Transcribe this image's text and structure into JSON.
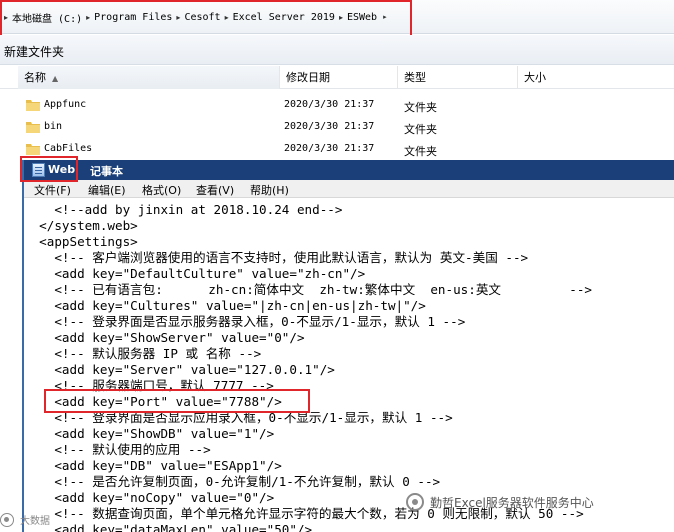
{
  "explorer": {
    "breadcrumb": [
      "本地磁盘 (C:)",
      "Program Files",
      "Cesoft",
      "Excel Server 2019",
      "ESWeb"
    ],
    "toolbar": {
      "new_folder_label": "新建文件夹"
    },
    "columns": {
      "name": "名称",
      "date": "修改日期",
      "type": "类型",
      "size": "大小"
    },
    "files": [
      {
        "name": "Appfunc",
        "date": "2020/3/30 21:37",
        "type": "文件夹"
      },
      {
        "name": "bin",
        "date": "2020/3/30 21:37",
        "type": "文件夹"
      },
      {
        "name": "CabFiles",
        "date": "2020/3/30 21:37",
        "type": "文件夹"
      }
    ]
  },
  "notepad": {
    "file_name": "Web",
    "app_title": "记事本",
    "menu": [
      "文件(F)",
      "编辑(E)",
      "格式(O)",
      "查看(V)",
      "帮助(H)"
    ],
    "lines": [
      "    <!--add by jinxin at 2018.10.24 end-->",
      "  </system.web>",
      "  <appSettings>",
      "    <!-- 客户端浏览器使用的语言不支持时，使用此默认语言，默认为 英文-美国 -->",
      "    <add key=\"DefaultCulture\" value=\"zh-cn\"/>",
      "    <!-- 已有语言包:      zh-cn:简体中文  zh-tw:繁体中文  en-us:英文         -->",
      "    <add key=\"Cultures\" value=\"|zh-cn|en-us|zh-tw|\"/>",
      "    <!-- 登录界面是否显示服务器录入框，0-不显示/1-显示，默认 1 -->",
      "    <add key=\"ShowServer\" value=\"0\"/>",
      "    <!-- 默认服务器 IP 或 名称 -->",
      "    <add key=\"Server\" value=\"127.0.0.1\"/>",
      "    <!-- 服务器端口号，默认 7777 -->",
      "    <add key=\"Port\" value=\"7788\"/>",
      "    <!-- 登录界面是否显示应用录入框，0-不显示/1-显示，默认 1 -->",
      "    <add key=\"ShowDB\" value=\"1\"/>",
      "    <!-- 默认使用的应用 -->",
      "    <add key=\"DB\" value=\"ESApp1\"/>",
      "    <!-- 是否允许复制页面，0-允许复制/1-不允许复制，默认 0 -->",
      "    <add key=\"noCopy\" value=\"0\"/>",
      "    <!-- 数据查询页面，单个单元格允许显示字符的最大个数，若为 0 则无限制，默认 50 -->",
      "    <add key=\"dataMaxLen\" value=\"50\"/>"
    ]
  },
  "watermark": {
    "text": "勤哲Excel服务器软件服务中心",
    "small_text": "大数据"
  },
  "colors": {
    "highlight_box": "#e0262b",
    "titlebar": "#1b3f79"
  }
}
